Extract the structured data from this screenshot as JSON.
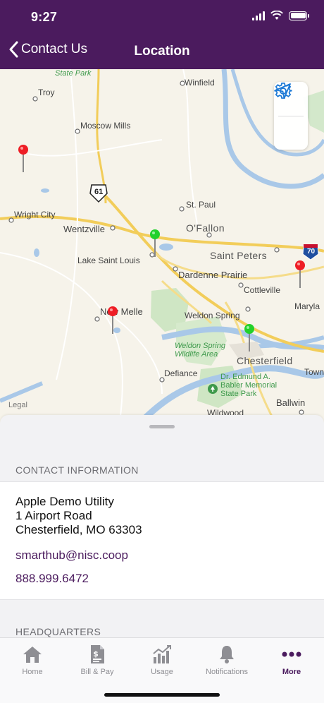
{
  "status_bar": {
    "time": "9:27"
  },
  "nav": {
    "back_label": "Contact Us",
    "title": "Location"
  },
  "map": {
    "legal": "Legal",
    "labels": [
      "Troy",
      "Winfield",
      "Moscow Mills",
      "61",
      "St. Paul",
      "Wright City",
      "Wentzville",
      "O'Fallon",
      "Saint Peters",
      "70",
      "Lake Saint Louis",
      "Dardenne Prairie",
      "Cottleville",
      "Marylа",
      "New Melle",
      "Weldon Spring",
      "Weldon Spring Wildlife Area",
      "Chesterfield",
      "Town and",
      "Defiance",
      "Dr. Edmund A. Babler Memorial State Park",
      "Ballwin",
      "Wildwood",
      "State Park"
    ],
    "pins": [
      {
        "color": "#ee1d25"
      },
      {
        "color": "#22d12b"
      },
      {
        "color": "#ee1d25"
      },
      {
        "color": "#ee1d25"
      },
      {
        "color": "#22d12b"
      }
    ]
  },
  "contact": {
    "header": "CONTACT INFORMATION",
    "name": "Apple Demo Utility",
    "street": "1 Airport Road",
    "city": "Chesterfield, MO 63303",
    "email": "smarthub@nisc.coop",
    "phone": "888.999.6472"
  },
  "headquarters": {
    "header": "HEADQUARTERS"
  },
  "tabs": [
    {
      "label": "Home",
      "icon": "home-icon"
    },
    {
      "label": "Bill & Pay",
      "icon": "bill-icon"
    },
    {
      "label": "Usage",
      "icon": "usage-icon"
    },
    {
      "label": "Notifications",
      "icon": "bell-icon"
    },
    {
      "label": "More",
      "icon": "more-icon"
    }
  ],
  "colors": {
    "brand": "#4b1b5e",
    "accent_blue": "#1e7ad6"
  }
}
